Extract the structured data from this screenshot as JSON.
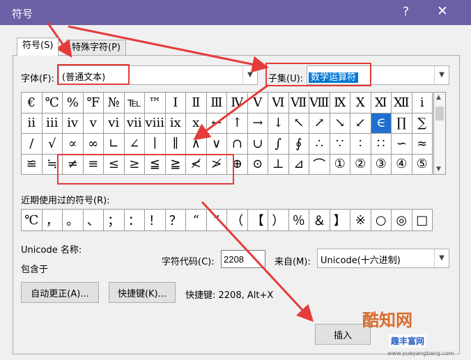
{
  "window": {
    "title": "符号",
    "help": "?",
    "close": "✕"
  },
  "tabs": [
    {
      "label": "符号(S)",
      "active": true
    },
    {
      "label": "特殊字符(P)",
      "active": false
    }
  ],
  "font": {
    "label": "字体(F):",
    "value": "(普通文本)"
  },
  "subset": {
    "label": "子集(U):",
    "value": "数学运算符"
  },
  "symbol_grid": [
    [
      "€",
      "℃",
      "%",
      "℉",
      "№",
      "℡",
      "™",
      "Ⅰ",
      "Ⅱ",
      "Ⅲ",
      "Ⅳ",
      "Ⅴ",
      "Ⅵ",
      "Ⅶ",
      "Ⅷ",
      "Ⅸ",
      "Ⅹ",
      "Ⅺ",
      "Ⅻ",
      "ⅰ"
    ],
    [
      "ⅱ",
      "ⅲ",
      "ⅳ",
      "ⅴ",
      "ⅵ",
      "ⅶ",
      "ⅷ",
      "ⅸ",
      "ⅹ",
      "←",
      "↑",
      "→",
      "↓",
      "↖",
      "↗",
      "↘",
      "↙",
      "∈",
      "∏",
      "∑"
    ],
    [
      "∕",
      "√",
      "∝",
      "∞",
      "∟",
      "∠",
      "∣",
      "∥",
      "∧",
      "∨",
      "∩",
      "∪",
      "∫",
      "∮",
      "∴",
      "∵",
      "∶",
      "∷",
      "∽",
      "≈"
    ],
    [
      "≌",
      "≒",
      "≠",
      "≡",
      "≤",
      "≥",
      "≦",
      "≧",
      "≮",
      "≯",
      "⊕",
      "⊙",
      "⊥",
      "⊿",
      "⌒",
      "①",
      "②",
      "③",
      "④",
      "⑤"
    ]
  ],
  "selected_symbol": "∈",
  "recent": {
    "label": "近期使用过的符号(R):",
    "symbols": [
      "℃",
      "，",
      "。",
      "、",
      "；",
      "：",
      "！",
      "？",
      "“",
      "”",
      "（",
      "【",
      "）",
      "％",
      "＆",
      "】",
      "※",
      "○",
      "◎",
      "□"
    ]
  },
  "unicode_name_label": "Unicode 名称:",
  "contained_in_label": "包含于",
  "char_code": {
    "label": "字符代码(C):",
    "value": "2208"
  },
  "from": {
    "label": "来自(M):",
    "value": "Unicode(十六进制)"
  },
  "buttons": {
    "autocorrect": "自动更正(A)...",
    "shortcut_key": "快捷键(K)...",
    "insert": "插入"
  },
  "shortcut_text": "快捷键: 2208, Alt+X",
  "watermark": {
    "logo": "酷知网",
    "site": "趣丰富网",
    "url": "www.yueyangbang.com"
  },
  "annotation_color": "#e53b3b"
}
